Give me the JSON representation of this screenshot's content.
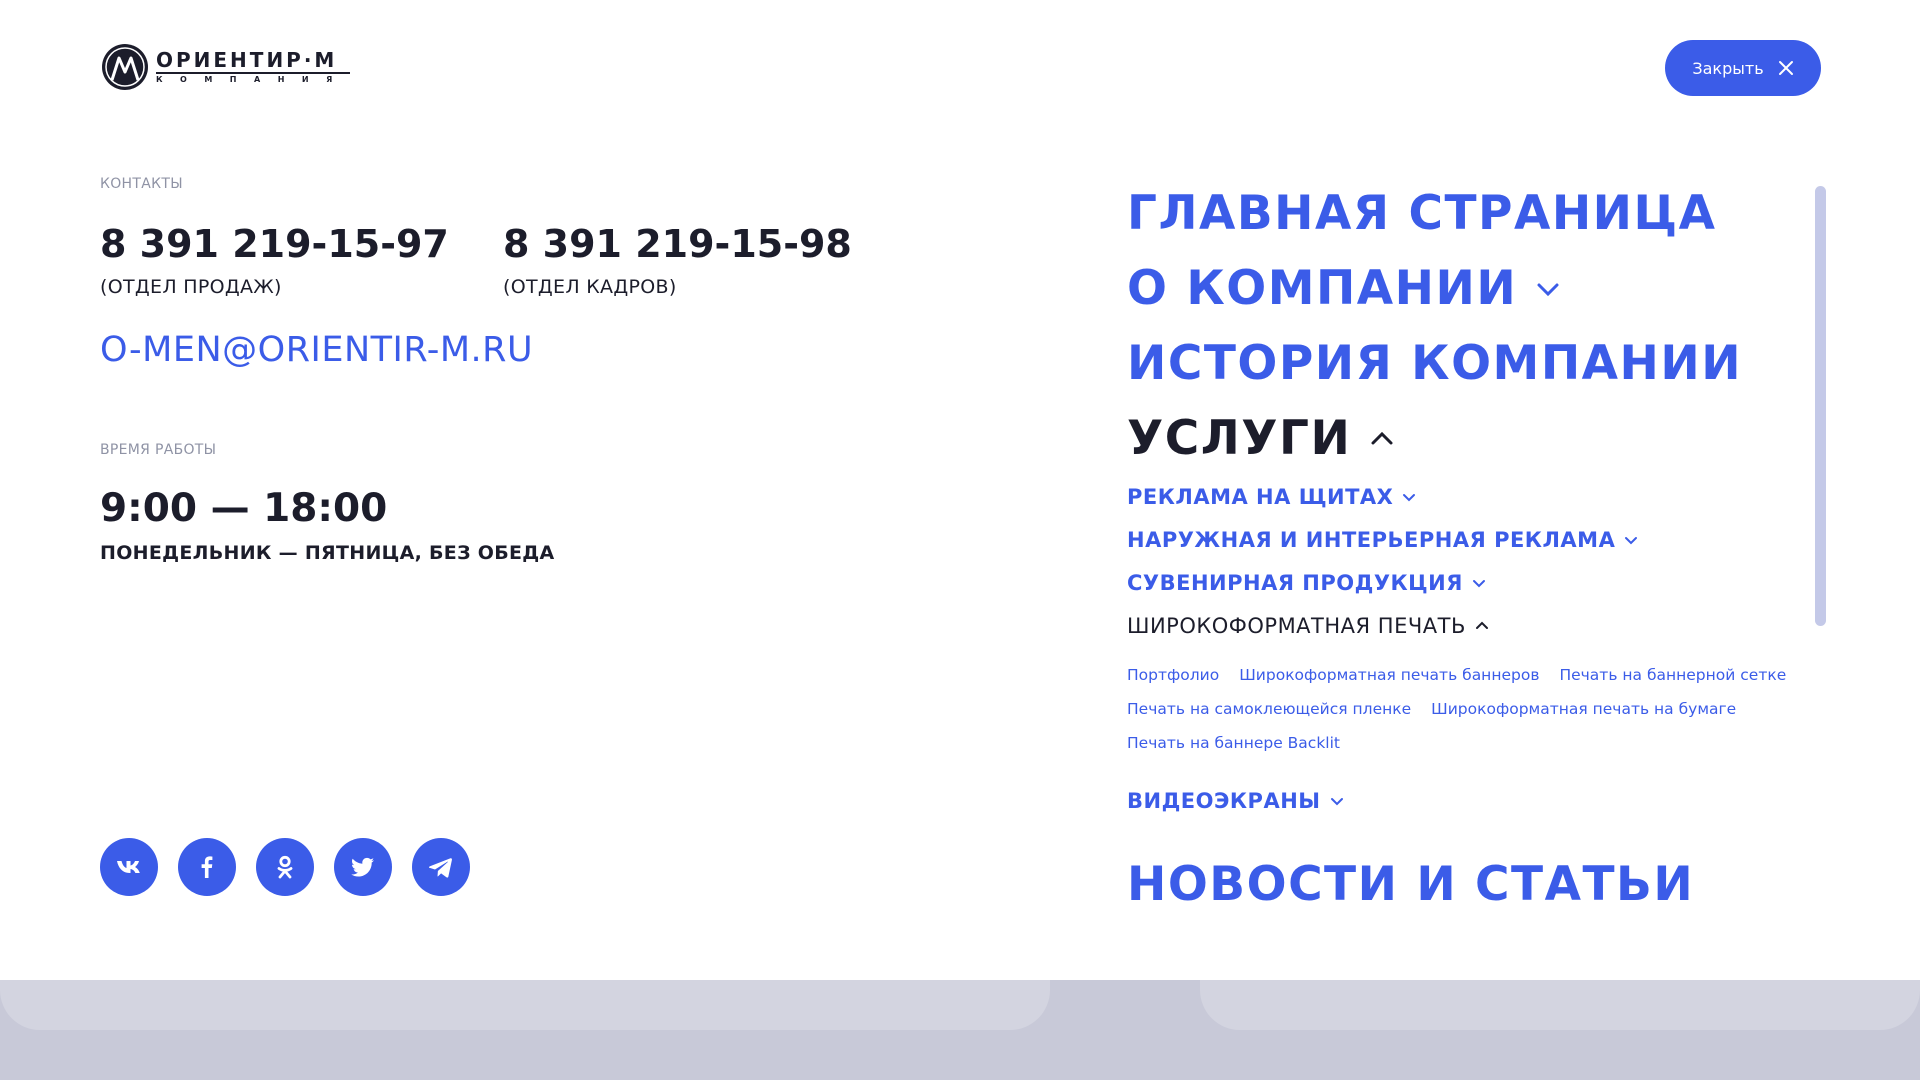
{
  "header": {
    "logo_title": "ОРИЕНТИР·М",
    "logo_subtitle": "КОМПАНИЯ",
    "close_label": "Закрыть"
  },
  "contacts": {
    "label": "КОНТАКТЫ",
    "phones": [
      {
        "number": "8 391 219-15-97",
        "note": "(ОТДЕЛ ПРОДАЖ)"
      },
      {
        "number": "8 391 219-15-98",
        "note": "(ОТДЕЛ КАДРОВ)"
      }
    ],
    "email": "O-MEN@ORIENTIR-M.RU"
  },
  "work_time": {
    "label": "ВРЕМЯ РАБОТЫ",
    "hours": "9:00 — 18:00",
    "days": "ПОНЕДЕЛЬНИК — ПЯТНИЦА, БЕЗ ОБЕДА"
  },
  "socials": [
    {
      "name": "vk-icon"
    },
    {
      "name": "facebook-icon"
    },
    {
      "name": "odnoklassniki-icon"
    },
    {
      "name": "twitter-icon"
    },
    {
      "name": "telegram-icon"
    }
  ],
  "nav": {
    "main": "ГЛАВНАЯ СТРАНИЦА",
    "about": "О КОМПАНИИ",
    "history": "ИСТОРИЯ КОМПАНИИ",
    "services": "УСЛУГИ",
    "news": "НОВОСТИ И СТАТЬИ"
  },
  "services": {
    "billboards": "РЕКЛАМА НА ЩИТАХ",
    "outdoor": "НАРУЖНАЯ И ИНТЕРЬЕРНАЯ РЕКЛАМА",
    "souvenirs": "СУВЕНИРНАЯ ПРОДУКЦИЯ",
    "wide_print": "ШИРОКОФОРМАТНАЯ ПЕЧАТЬ",
    "video": "ВИДЕОЭКРАНЫ"
  },
  "wide_print_links": [
    "Портфолио",
    "Широкоформатная печать баннеров",
    "Печать на баннерной сетке",
    "Печать на самоклеющейся пленке",
    "Широкоформатная печать на бумаге",
    "Печать на баннере Backlit"
  ],
  "colors": {
    "accent": "#3b5ce8",
    "text": "#1c1d2b",
    "muted": "#8f93a5"
  }
}
